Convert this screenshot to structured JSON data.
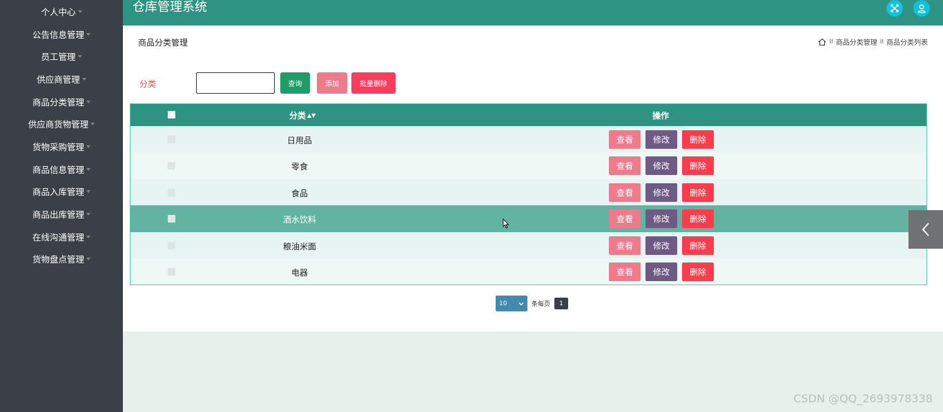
{
  "app": {
    "title": "仓库管理系统"
  },
  "sidebar": {
    "items": [
      {
        "label": "个人中心"
      },
      {
        "label": "公告信息管理"
      },
      {
        "label": "员工管理"
      },
      {
        "label": "供应商管理"
      },
      {
        "label": "商品分类管理"
      },
      {
        "label": "供应商货物管理"
      },
      {
        "label": "货物采购管理"
      },
      {
        "label": "商品信息管理"
      },
      {
        "label": "商品入库管理"
      },
      {
        "label": "商品出库管理"
      },
      {
        "label": "在线沟通管理"
      },
      {
        "label": "货物盘点管理"
      }
    ]
  },
  "page": {
    "title": "商品分类管理",
    "breadcrumb": {
      "sep": "II",
      "items": [
        "商品分类管理",
        "商品分类列表"
      ]
    }
  },
  "filter": {
    "label": "分类",
    "value": "",
    "search_label": "查询",
    "add_label": "添加",
    "bulk_delete_label": "批量删除"
  },
  "table": {
    "headers": {
      "category": "分类",
      "sort_icon": "sort-icon",
      "operations": "操作"
    },
    "rows": [
      {
        "category": "日用品"
      },
      {
        "category": "零食"
      },
      {
        "category": "食品"
      },
      {
        "category": "酒水饮料"
      },
      {
        "category": "粮油米面"
      },
      {
        "category": "电器"
      }
    ],
    "actions": {
      "view": "查看",
      "edit": "修改",
      "delete": "删除"
    }
  },
  "pagination": {
    "page_size": "10",
    "per_page_label": "条每页",
    "current_page": "1"
  },
  "watermark": "CSDN @QQ_2693978338",
  "colors": {
    "header": "#2f9384",
    "sidebar": "#3b4048",
    "search": "#1f9d68",
    "view": "#ee7b8c",
    "edit": "#6e5a84",
    "delete": "#fb3c4c"
  }
}
